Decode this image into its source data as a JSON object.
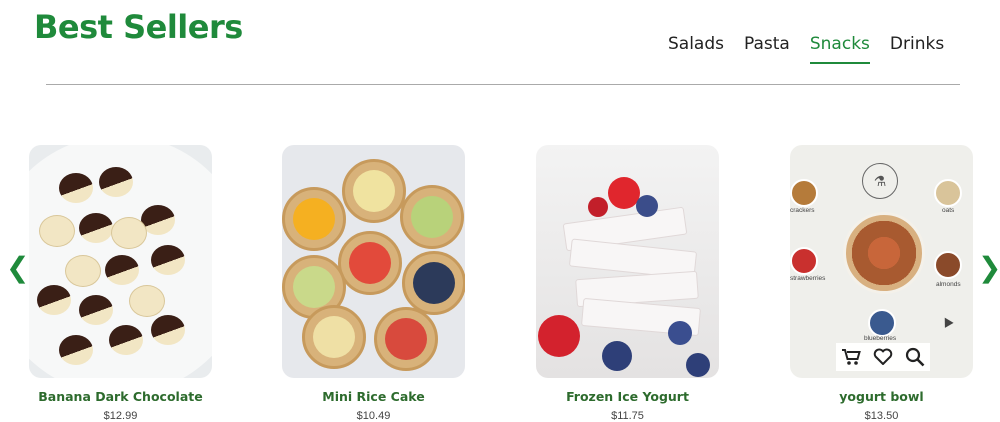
{
  "page": {
    "title": "Best Sellers"
  },
  "tabs": [
    {
      "label": "Salads",
      "active": false
    },
    {
      "label": "Pasta",
      "active": false
    },
    {
      "label": "Snacks",
      "active": true
    },
    {
      "label": "Drinks",
      "active": false
    }
  ],
  "carousel": {
    "prev_icon": "❮",
    "next_icon": "❯"
  },
  "products": [
    {
      "name": "Banana Dark Chocolate",
      "price": "$12.99"
    },
    {
      "name": "Mini Rice Cake",
      "price": "$10.49"
    },
    {
      "name": "Frozen Ice Yogurt",
      "price": "$11.75"
    },
    {
      "name": "yogurt bowl",
      "price": "$13.50"
    }
  ],
  "bowl_image": {
    "labels": [
      "crackers",
      "oats",
      "strawberries",
      "almonds",
      "blueberries"
    ]
  },
  "colors": {
    "brand": "#1f8a3b",
    "product_name": "#2d6b2d"
  }
}
